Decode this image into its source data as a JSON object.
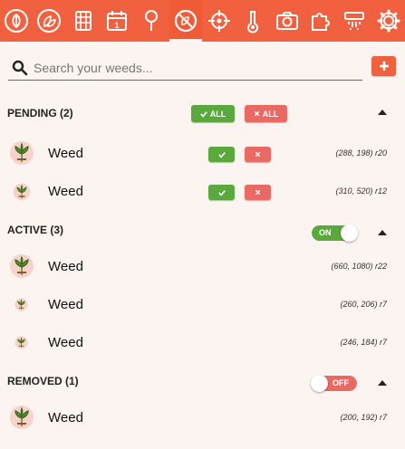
{
  "colors": {
    "accent": "#f1613f",
    "confirm": "#5aa83e",
    "reject": "#e86a63",
    "background": "#fbf4f0"
  },
  "tabs": [
    {
      "icon": "leaf-icon"
    },
    {
      "icon": "leaves-icon"
    },
    {
      "icon": "grid-icon"
    },
    {
      "icon": "calendar-icon"
    },
    {
      "icon": "probe-icon"
    },
    {
      "icon": "no-weeds-icon",
      "active": true
    },
    {
      "icon": "crosshair-icon"
    },
    {
      "icon": "thermometer-icon"
    },
    {
      "icon": "camera-icon"
    },
    {
      "icon": "puzzle-icon"
    },
    {
      "icon": "sprinkler-icon"
    },
    {
      "icon": "gear-icon"
    }
  ],
  "search": {
    "placeholder": "Search your weeds...",
    "value": ""
  },
  "add_label": "+",
  "pending": {
    "title": "PENDING (2)",
    "all_accept_label": "ALL",
    "all_reject_label": "ALL",
    "items": [
      {
        "name": "Weed",
        "coords": "(288, 198) r20"
      },
      {
        "name": "Weed",
        "coords": "(310, 520) r12"
      }
    ]
  },
  "active": {
    "title": "ACTIVE (3)",
    "toggle_label": "ON",
    "items": [
      {
        "name": "Weed",
        "coords": "(660, 1080) r22"
      },
      {
        "name": "Weed",
        "coords": "(260, 206) r7"
      },
      {
        "name": "Weed",
        "coords": "(246, 184) r7"
      }
    ]
  },
  "removed": {
    "title": "REMOVED (1)",
    "toggle_label": "OFF",
    "items": [
      {
        "name": "Weed",
        "coords": "(200, 192) r7"
      }
    ]
  }
}
